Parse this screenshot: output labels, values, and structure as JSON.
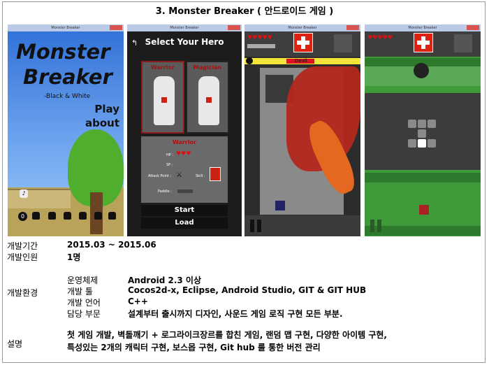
{
  "title": "3.   Monster Breaker ( 안드로이드 게임 )",
  "screens": {
    "s1": {
      "window_title": "Monster Breaker",
      "logo_line1": "Monster",
      "logo_line2": "Breaker",
      "logo_sub": "-Black & White",
      "menu_play": "Play",
      "menu_about": "about",
      "stage_badge": "0"
    },
    "s2": {
      "window_title": "Monster Breaker",
      "heading": "Select Your Hero",
      "hero1": "Warrior",
      "hero2": "Magician",
      "panel_title": "Warrior",
      "hp_label": "HP :",
      "sp_label": "SP :",
      "attack_label": "Attack Point :",
      "skill_label": "Skill :",
      "paddle_label": "Paddle :",
      "start": "Start",
      "load": "Load"
    },
    "s3": {
      "window_title": "Monster Breaker",
      "boss_name": "Devil"
    },
    "s4": {
      "window_title": "Monster Breaker"
    }
  },
  "rows": {
    "period_label": "개발기간",
    "period_value": "2015.03 ~ 2015.06",
    "people_label": "개발인원",
    "people_value": "1명",
    "env_label": "개발환경",
    "env": [
      {
        "k": "운영체제",
        "v": "Android 2.3 이상"
      },
      {
        "k": "개발 툴",
        "v": "Cocos2d-x, Eclipse, Android Studio, GIT & GIT HUB"
      },
      {
        "k": "개발 언어",
        "v": "C++"
      },
      {
        "k": "담당 부문",
        "v": "설계부터 출시까지 디자인, 사운드 게임 로직 구현 모든 부분."
      }
    ],
    "desc_label": "설명",
    "desc_line1": "첫 게임 개발, 벽돌깨기 + 로그라이크장르를 합친 게임, 랜덤 맵 구현, 다양한 아이템 구현,",
    "desc_line2": "특성있는 2개의 캐릭터 구현, 보스몹 구현, Git hub 를 통한 버전 관리"
  },
  "colors": {
    "heart": "#dd1111",
    "medkit": "#dd2211",
    "boss_bar": "#f3e53a"
  }
}
